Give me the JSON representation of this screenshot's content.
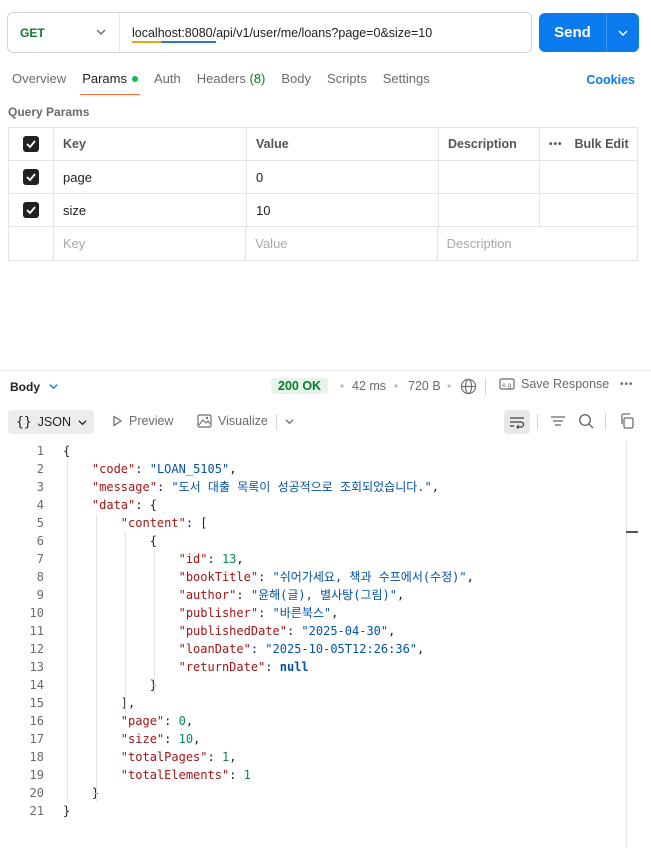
{
  "request": {
    "method": "GET",
    "url": "localhost:8080/api/v1/user/me/loans?page=0&size=10",
    "send_label": "Send"
  },
  "tabs": {
    "overview": "Overview",
    "params": "Params",
    "auth": "Auth",
    "headers": "Headers",
    "headers_count": "(8)",
    "body": "Body",
    "scripts": "Scripts",
    "settings": "Settings",
    "cookies": "Cookies"
  },
  "query_params": {
    "title": "Query Params",
    "columns": {
      "key": "Key",
      "value": "Value",
      "description": "Description",
      "bulk_edit": "Bulk Edit"
    },
    "rows": [
      {
        "key": "page",
        "value": "0",
        "checked": true
      },
      {
        "key": "size",
        "value": "10",
        "checked": true
      }
    ],
    "placeholder": {
      "key": "Key",
      "value": "Value",
      "description": "Description"
    }
  },
  "response": {
    "body_label": "Body",
    "status": "200 OK",
    "time": "42 ms",
    "size": "720 B",
    "save_label": "Save Response",
    "format": "JSON",
    "preview": "Preview",
    "visualize": "Visualize"
  },
  "code_lines": [
    {
      "n": "1",
      "html": "{"
    },
    {
      "n": "2",
      "html": "    <span class=\"k\">\"code\"</span>: <span class=\"s\">\"LOAN_5105\"</span>,"
    },
    {
      "n": "3",
      "html": "    <span class=\"k\">\"message\"</span>: <span class=\"s\">\"도서 대출 목록이 성공적으로 조회되었습니다.\"</span>,"
    },
    {
      "n": "4",
      "html": "    <span class=\"k\">\"data\"</span>: {"
    },
    {
      "n": "5",
      "html": "        <span class=\"k\">\"content\"</span>: ["
    },
    {
      "n": "6",
      "html": "            {"
    },
    {
      "n": "7",
      "html": "                <span class=\"k\">\"id\"</span>: <span class=\"n\">13</span>,"
    },
    {
      "n": "8",
      "html": "                <span class=\"k\">\"bookTitle\"</span>: <span class=\"s\">\"쉬어가세요, 책과 수프에서(수정)\"</span>,"
    },
    {
      "n": "9",
      "html": "                <span class=\"k\">\"author\"</span>: <span class=\"s\">\"윤해(글), 별사탕(그림)\"</span>,"
    },
    {
      "n": "10",
      "html": "                <span class=\"k\">\"publisher\"</span>: <span class=\"s\">\"바른북스\"</span>,"
    },
    {
      "n": "11",
      "html": "                <span class=\"k\">\"publishedDate\"</span>: <span class=\"s\">\"2025-04-30\"</span>,"
    },
    {
      "n": "12",
      "html": "                <span class=\"k\">\"loanDate\"</span>: <span class=\"s\">\"2025-10-05T12:26:36\"</span>,"
    },
    {
      "n": "13",
      "html": "                <span class=\"k\">\"returnDate\"</span>: <span class=\"nl\">null</span>"
    },
    {
      "n": "14",
      "html": "            }"
    },
    {
      "n": "15",
      "html": "        ],"
    },
    {
      "n": "16",
      "html": "        <span class=\"k\">\"page\"</span>: <span class=\"n\">0</span>,"
    },
    {
      "n": "17",
      "html": "        <span class=\"k\">\"size\"</span>: <span class=\"n\">10</span>,"
    },
    {
      "n": "18",
      "html": "        <span class=\"k\">\"totalPages\"</span>: <span class=\"n\">1</span>,"
    },
    {
      "n": "19",
      "html": "        <span class=\"k\">\"totalElements\"</span>: <span class=\"n\">1</span>"
    },
    {
      "n": "20",
      "html": "    }"
    },
    {
      "n": "21",
      "html": "}"
    }
  ],
  "colors": {
    "accent": "#097bed",
    "active_tab": "#ff6c37",
    "status_ok": "#0a7a2c"
  },
  "icons": [
    "chevron-down-icon",
    "globe-icon",
    "save-response-icon",
    "more-icon",
    "preview-icon",
    "visualize-icon",
    "wrap-icon",
    "filter-icon",
    "search-icon",
    "copy-icon",
    "check-icon"
  ]
}
